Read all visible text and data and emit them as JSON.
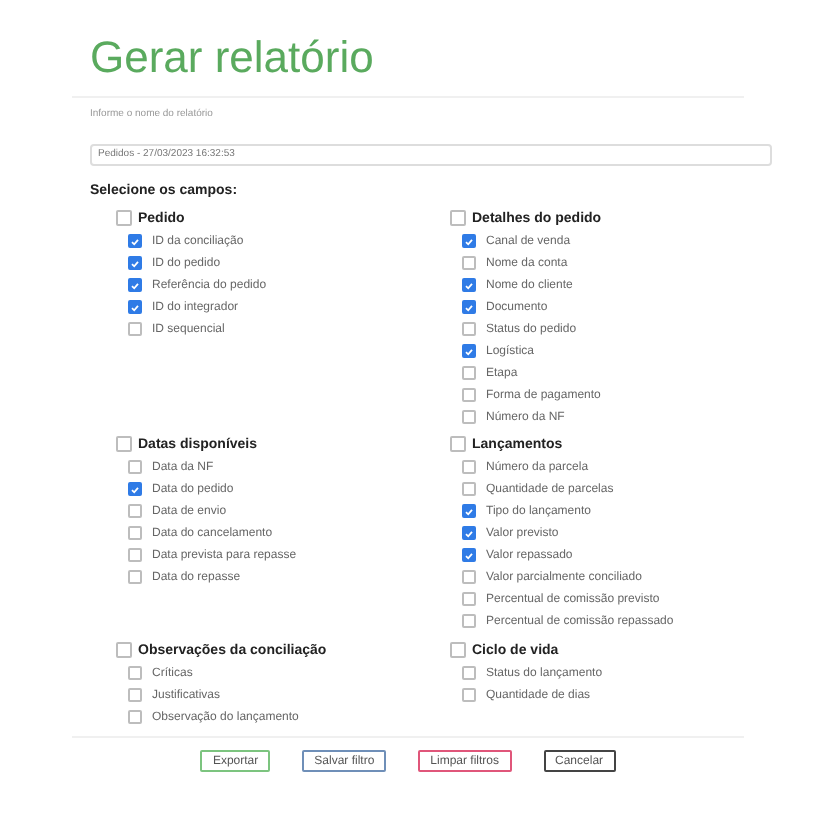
{
  "title": "Gerar relatório",
  "report_name": {
    "label": "Informe o nome do relatório",
    "value": "Pedidos - 27/03/2023 16:32:53"
  },
  "fields_heading": "Selecione os campos:",
  "groups": [
    {
      "label": "Pedido",
      "checked": false,
      "items": [
        {
          "label": "ID da conciliação",
          "checked": true
        },
        {
          "label": "ID do pedido",
          "checked": true
        },
        {
          "label": "Referência do pedido",
          "checked": true
        },
        {
          "label": "ID do integrador",
          "checked": true
        },
        {
          "label": "ID sequencial",
          "checked": false
        }
      ]
    },
    {
      "label": "Detalhes do pedido",
      "checked": false,
      "items": [
        {
          "label": "Canal de venda",
          "checked": true
        },
        {
          "label": "Nome da conta",
          "checked": false
        },
        {
          "label": "Nome do cliente",
          "checked": true
        },
        {
          "label": "Documento",
          "checked": true
        },
        {
          "label": "Status do pedido",
          "checked": false
        },
        {
          "label": "Logística",
          "checked": true
        },
        {
          "label": "Etapa",
          "checked": false
        },
        {
          "label": "Forma de pagamento",
          "checked": false
        },
        {
          "label": "Número da NF",
          "checked": false
        }
      ]
    },
    {
      "label": "Datas disponíveis",
      "checked": false,
      "items": [
        {
          "label": "Data da NF",
          "checked": false
        },
        {
          "label": "Data do pedido",
          "checked": true
        },
        {
          "label": "Data de envio",
          "checked": false
        },
        {
          "label": "Data do cancelamento",
          "checked": false
        },
        {
          "label": "Data prevista para repasse",
          "checked": false
        },
        {
          "label": "Data do repasse",
          "checked": false
        }
      ]
    },
    {
      "label": "Lançamentos",
      "checked": false,
      "items": [
        {
          "label": "Número da parcela",
          "checked": false
        },
        {
          "label": "Quantidade de parcelas",
          "checked": false
        },
        {
          "label": "Tipo do lançamento",
          "checked": true
        },
        {
          "label": "Valor previsto",
          "checked": true
        },
        {
          "label": "Valor repassado",
          "checked": true
        },
        {
          "label": "Valor parcialmente conciliado",
          "checked": false
        },
        {
          "label": "Percentual de comissão previsto",
          "checked": false
        },
        {
          "label": "Percentual de comissão repassado",
          "checked": false
        }
      ]
    },
    {
      "label": "Observações da conciliação",
      "checked": false,
      "items": [
        {
          "label": "Críticas",
          "checked": false
        },
        {
          "label": "Justificativas",
          "checked": false
        },
        {
          "label": "Observação do lançamento",
          "checked": false
        }
      ]
    },
    {
      "label": "Ciclo de vida",
      "checked": false,
      "items": [
        {
          "label": "Status do lançamento",
          "checked": false
        },
        {
          "label": "Quantidade de dias",
          "checked": false
        }
      ]
    }
  ],
  "buttons": [
    {
      "label": "Exportar",
      "kind": "export"
    },
    {
      "label": "Salvar filtro",
      "kind": "save"
    },
    {
      "label": "Limpar filtros",
      "kind": "clear"
    },
    {
      "label": "Cancelar",
      "kind": "cancel"
    }
  ]
}
